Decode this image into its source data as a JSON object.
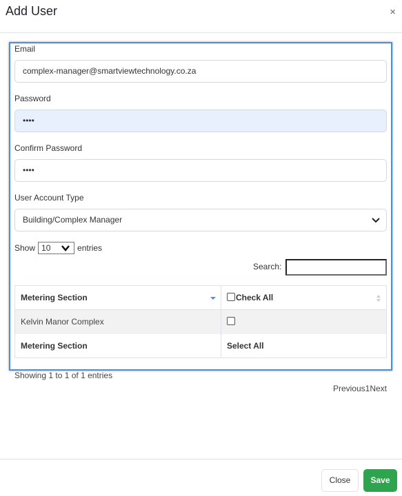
{
  "modal": {
    "title": "Add User",
    "close_icon": "×"
  },
  "form": {
    "email": {
      "label": "Email",
      "value": "complex-manager@smartviewtechnology.co.za"
    },
    "password": {
      "label": "Password",
      "value": "••••"
    },
    "confirm_password": {
      "label": "Confirm Password",
      "value": "••••"
    },
    "account_type": {
      "label": "User Account Type",
      "selected": "Building/Complex Manager"
    }
  },
  "datatable": {
    "show_label": "Show",
    "page_length": "10",
    "entries_label": "entries",
    "search_label": "Search:",
    "search_value": "",
    "columns": [
      "Metering Section",
      "Check All"
    ],
    "rows": [
      {
        "section": "Kelvin Manor Complex",
        "checked": false
      }
    ],
    "footer": [
      "Metering Section",
      "Select All"
    ],
    "info": "Showing 1 to 1 of 1 entries",
    "pagination": {
      "previous": "Previous",
      "page": "1",
      "next": "Next"
    }
  },
  "buttons": {
    "close": "Close",
    "save": "Save"
  },
  "colors": {
    "accent": "#4a90e2",
    "save": "#2ea44f",
    "autofill": "#e8f0fe"
  }
}
